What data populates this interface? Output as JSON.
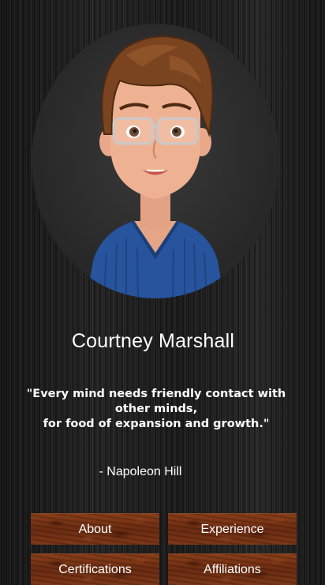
{
  "profile": {
    "name": "Courtney Marshall",
    "avatar_icon": "cartoon-avatar-portrait"
  },
  "quote": {
    "lines": [
      "\"Every mind needs friendly contact with",
      "other minds,",
      "for food of expansion and growth.\""
    ],
    "author": "- Napoleon Hill"
  },
  "nav": {
    "about": "About",
    "experience": "Experience",
    "certifications": "Certifications",
    "affiliations": "Affiliations"
  },
  "colors": {
    "background": "#1a1a1a",
    "button_wood": "#6e2f14",
    "text": "#ffffff"
  }
}
